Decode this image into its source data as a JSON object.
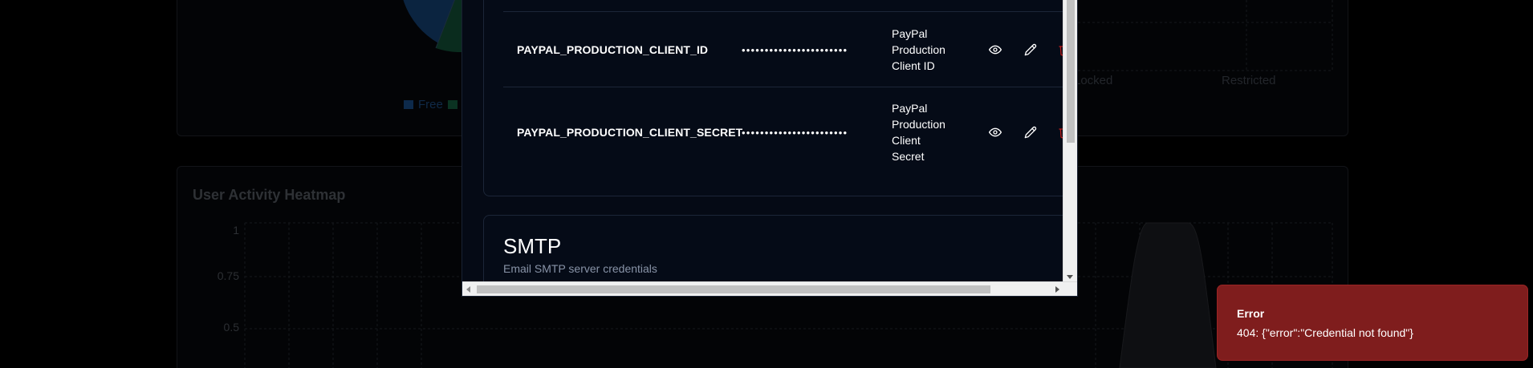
{
  "background": {
    "pie_legend": [
      "Free",
      ""
    ],
    "bar_axis_labels": [
      "Locked",
      "Restricted"
    ],
    "heatmap": {
      "title": "User Activity Heatmap",
      "y_ticks": [
        "1",
        "0.75",
        "0.5"
      ]
    }
  },
  "modal": {
    "credentials": [
      {
        "key": "PAYPAL_PRODUCTION_CLIENT_ID",
        "masked_value": "•••••••••••••••••••••••",
        "description_lines": [
          "PayPal",
          "Production",
          "Client ID"
        ]
      },
      {
        "key": "PAYPAL_PRODUCTION_CLIENT_SECRET",
        "masked_value": "•••••••••••••••••••••••",
        "description_lines": [
          "PayPal",
          "Production",
          "Client",
          "Secret"
        ]
      }
    ],
    "smtp": {
      "title": "SMTP",
      "subtitle": "Email SMTP server credentials"
    },
    "icons": {
      "view": "eye-icon",
      "edit": "pencil-icon",
      "delete": "trash-icon"
    }
  },
  "toast": {
    "title": "Error",
    "message": "404: {\"error\":\"Credential not found\"}",
    "color": "#7f1d1d"
  }
}
